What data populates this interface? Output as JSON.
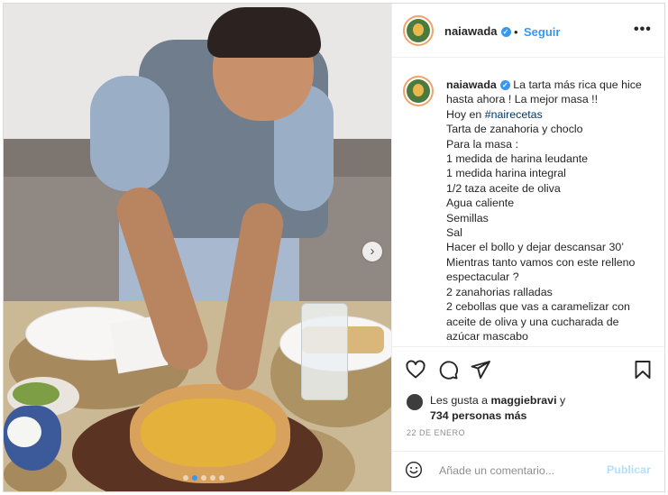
{
  "post": {
    "username": "naiawada",
    "follow_label": "Seguir",
    "separator": "•",
    "more_label": "•••",
    "caption_lines": [
      "La tarta más rica que hice",
      "hasta ahora ! La mejor masa !!",
      "Hoy en #nairecetas",
      "Tarta de zanahoria y choclo",
      "Para la masa :",
      "1 medida de harina leudante",
      "1 medida harina integral",
      "1/2 taza aceite de oliva",
      "Agua caliente",
      "Semillas",
      "Sal",
      "Hacer el bollo y dejar descansar 30’",
      "Mientras tanto vamos con este relleno",
      "espectacular ?",
      "2 zanahorias ralladas",
      "2 cebollas que vas a caramelizar con",
      "aceite de oliva y una cucharada de",
      "azúcar mascabo"
    ],
    "likes_prefix": "Les gusta a ",
    "likes_user": "maggiebravi",
    "likes_suffix": " y",
    "likes_count_text": "734 personas más",
    "date": "22 DE ENERO",
    "comment_placeholder": "Añade un comentario...",
    "publish_label": "Publicar",
    "carousel": {
      "total_images": 5,
      "current_index": 1
    },
    "icons": {
      "verified": "verified-badge-icon",
      "more": "more-options-icon",
      "like": "heart-icon",
      "comment": "comment-icon",
      "share": "paper-plane-icon",
      "save": "bookmark-icon",
      "emoji": "smiley-icon",
      "next": "chevron-right-icon"
    },
    "colors": {
      "link_blue": "#3897f0",
      "publish_disabled": "#b2dffc",
      "text": "#262626",
      "muted": "#8e8e8e"
    }
  }
}
